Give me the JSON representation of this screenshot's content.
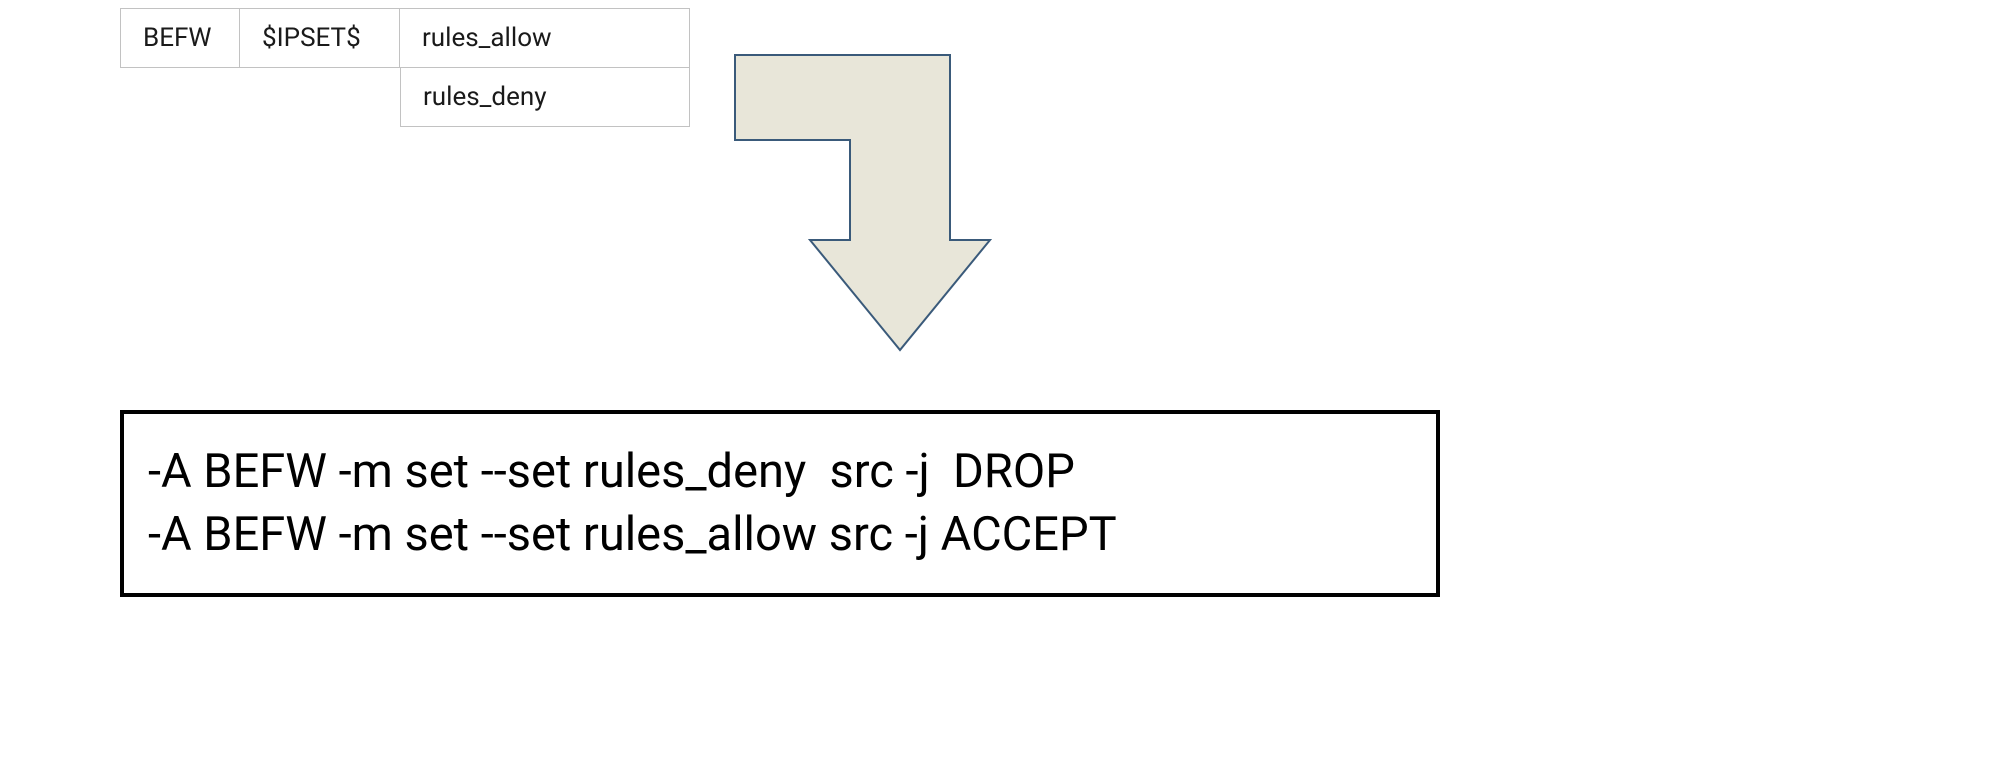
{
  "table": {
    "cell_befw": "BEFW",
    "cell_ipset": "$IPSET$",
    "cell_rules_allow": "rules_allow",
    "cell_rules_deny": "rules_deny"
  },
  "arrow": {
    "fill": "#e8e6d9",
    "stroke": "#3a5a7a"
  },
  "result": {
    "line1": "-A BEFW -m set --set rules_deny  src -j  DROP",
    "line2": "-A BEFW -m set --set rules_allow src -j ACCEPT"
  }
}
